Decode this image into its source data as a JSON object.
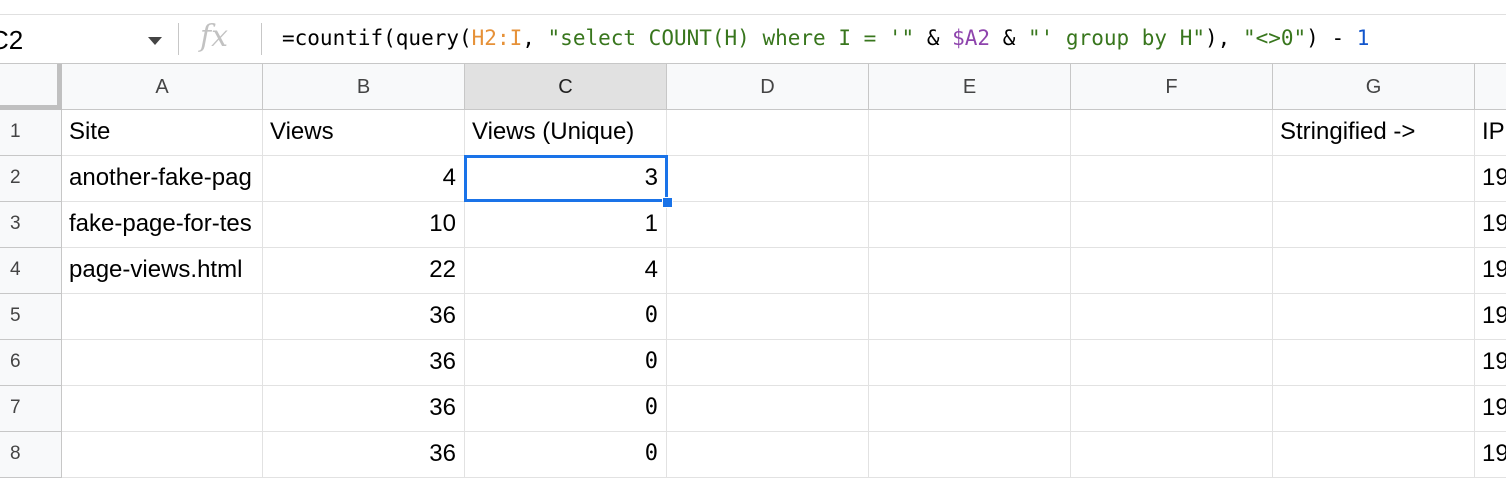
{
  "name_box": {
    "value": "C2"
  },
  "formula_bar": {
    "fx_label": "fx",
    "tokens": [
      {
        "text": "=countif(query(",
        "type": "plain"
      },
      {
        "text": "H2:I",
        "type": "range"
      },
      {
        "text": ", ",
        "type": "plain"
      },
      {
        "text": "\"select COUNT(H) where I = '\"",
        "type": "str"
      },
      {
        "text": " & ",
        "type": "plain"
      },
      {
        "text": "$A2",
        "type": "ref"
      },
      {
        "text": " & ",
        "type": "plain"
      },
      {
        "text": "\"' group by H\"",
        "type": "str"
      },
      {
        "text": "), ",
        "type": "plain"
      },
      {
        "text": "\"<>0\"",
        "type": "str"
      },
      {
        "text": ") - ",
        "type": "plain"
      },
      {
        "text": "1",
        "type": "num"
      }
    ]
  },
  "sheet": {
    "columns": [
      "A",
      "B",
      "C",
      "D",
      "E",
      "F",
      "G",
      ""
    ],
    "selected_column": "C",
    "rows": [
      {
        "num": "1",
        "cells": [
          "Site",
          "Views",
          "Views (Unique)",
          "",
          "",
          "",
          "Stringified ->",
          "IP"
        ]
      },
      {
        "num": "2",
        "cells": [
          "another-fake-pag",
          "4",
          "3",
          "",
          "",
          "",
          "",
          "19"
        ]
      },
      {
        "num": "3",
        "cells": [
          "fake-page-for-tes",
          "10",
          "1",
          "",
          "",
          "",
          "",
          "19"
        ]
      },
      {
        "num": "4",
        "cells": [
          "page-views.html",
          "22",
          "4",
          "",
          "",
          "",
          "",
          "19"
        ]
      },
      {
        "num": "5",
        "cells": [
          "",
          "36",
          "0",
          "",
          "",
          "",
          "",
          "19"
        ]
      },
      {
        "num": "6",
        "cells": [
          "",
          "36",
          "0",
          "",
          "",
          "",
          "",
          "19"
        ]
      },
      {
        "num": "7",
        "cells": [
          "",
          "36",
          "0",
          "",
          "",
          "",
          "",
          "19"
        ]
      },
      {
        "num": "8",
        "cells": [
          "",
          "36",
          "0",
          "",
          "",
          "",
          "",
          "19"
        ]
      }
    ]
  },
  "colors": {
    "selection": "#1a73e8",
    "range_token": "#e69138",
    "string_token": "#38761d",
    "ref_token": "#8e44ad",
    "number_token": "#1155cc"
  }
}
